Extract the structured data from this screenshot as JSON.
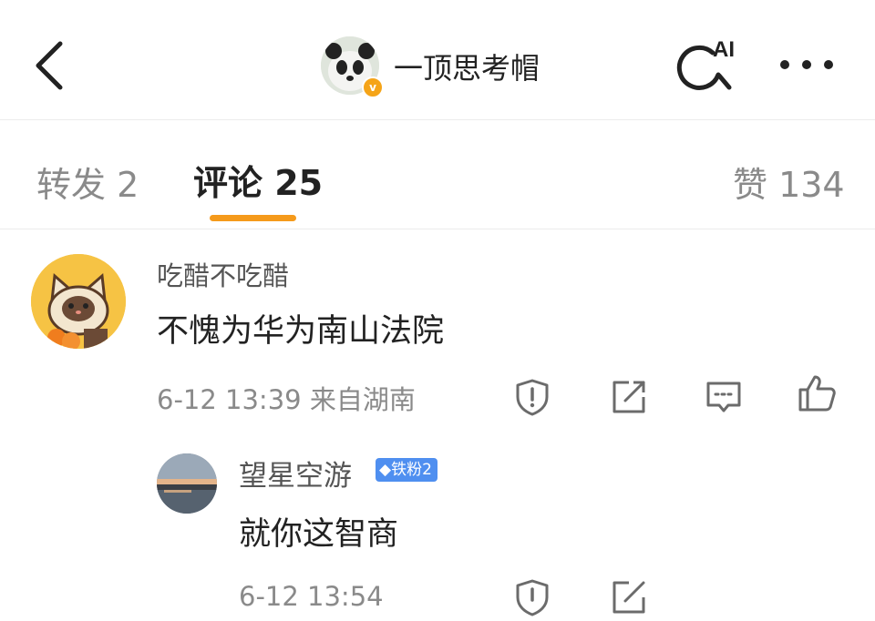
{
  "header": {
    "author_name": "一顶思考帽",
    "verified_mark": "v",
    "ai_label": "AI"
  },
  "tabs": [
    {
      "label": "转发 2",
      "active": false
    },
    {
      "label": "评论 25",
      "active": true
    },
    {
      "label": "赞 134",
      "active": false
    }
  ],
  "comments": [
    {
      "user": "吃醋不吃醋",
      "text": "不愧为华为南山法院",
      "meta": "6-12 13:39  来自湖南",
      "actions": [
        "report-icon",
        "share-icon",
        "reply-icon",
        "like-icon"
      ]
    }
  ],
  "replies": [
    {
      "user": "望星空游",
      "badge": "铁粉2",
      "text": "就你这智商",
      "meta": "6-12 13:54"
    }
  ],
  "colors": {
    "accent": "#f59a1b",
    "badge": "#4f8ff0",
    "muted": "#8a8a8a"
  }
}
